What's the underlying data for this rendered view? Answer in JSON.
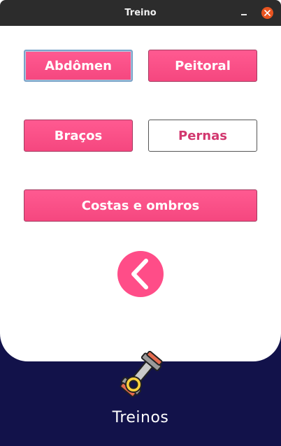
{
  "window": {
    "title": "Treino"
  },
  "workouts": {
    "abdomen": "Abdômen",
    "peitoral": "Peitoral",
    "bracos": "Braços",
    "pernas": "Pernas",
    "costas": "Costas e ombros"
  },
  "footer": {
    "label": "Treinos",
    "icon": "dumbbell-icon"
  },
  "colors": {
    "accent": "#ff4d88",
    "footer_bg": "#12124a",
    "titlebar": "#2c2c2c",
    "close": "#e95420"
  }
}
